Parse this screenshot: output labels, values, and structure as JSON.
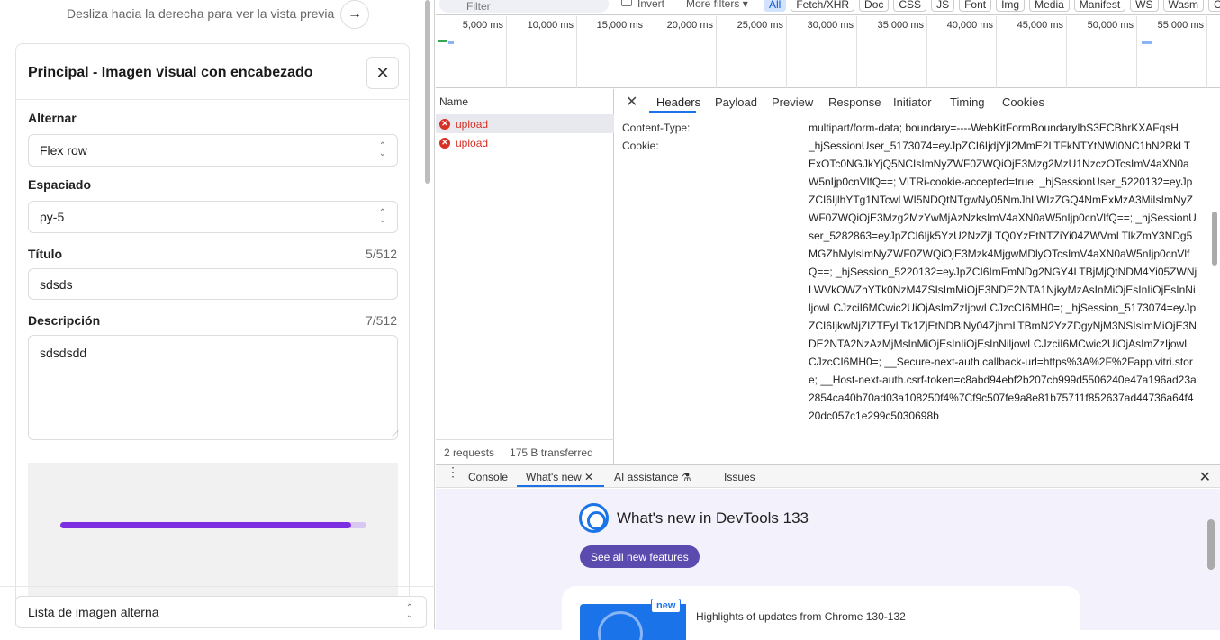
{
  "left": {
    "hint": "Desliza hacia la derecha para ver la vista previa",
    "panel": {
      "title": "Principal - Imagen visual con encabezado",
      "alternar": {
        "label": "Alternar",
        "value": "Flex row"
      },
      "espaciado": {
        "label": "Espaciado",
        "value": "py-5"
      },
      "titulo": {
        "label": "Título",
        "count": "5/512",
        "value": "sdsds"
      },
      "descripcion": {
        "label": "Descripción",
        "count": "7/512",
        "value": "sdsdsdd"
      },
      "progress": 0.95
    },
    "bottom_select": "Lista de imagen alterna"
  },
  "devtools": {
    "filter": {
      "placeholder": "Filter",
      "invert": "Invert",
      "more_filters": "More filters",
      "chips": [
        "All",
        "Fetch/XHR",
        "Doc",
        "CSS",
        "JS",
        "Font",
        "Img",
        "Media",
        "Manifest",
        "WS",
        "Wasm",
        "Other"
      ]
    },
    "timeline_ticks": [
      "5,000 ms",
      "10,000 ms",
      "15,000 ms",
      "20,000 ms",
      "25,000 ms",
      "30,000 ms",
      "35,000 ms",
      "40,000 ms",
      "45,000 ms",
      "50,000 ms",
      "55,000 ms"
    ],
    "name_header": "Name",
    "requests": [
      "upload",
      "upload"
    ],
    "status": {
      "requests": "2 requests",
      "transferred": "175 B transferred"
    },
    "tabs": [
      "Headers",
      "Payload",
      "Preview",
      "Response",
      "Initiator",
      "Timing",
      "Cookies"
    ],
    "headers": [
      {
        "name": "Content-Type:",
        "value": "multipart/form-data; boundary=----WebKitFormBoundaryIbS3ECBhrKXAFqsH"
      },
      {
        "name": "Cookie:",
        "value": "_hjSessionUser_5173074=eyJpZCI6IjdjYjI2MmE2LTFkNTYtNWI0NC1hN2RkLTExOTc0NGJkYjQ5NCIsImNyZWF0ZWQiOjE3Mzg2MzU1NzczOTcsImV4aXN0aW5nIjp0cnVlfQ==; VITRi-cookie-accepted=true; _hjSessionUser_5220132=eyJpZCI6IjlhYTg1NTcwLWI5NDQtNTgwNy05NmJhLWIzZGQ4NmExMzA3MiIsImNyZWF0ZWQiOjE3Mzg2MzYwMjAzNzksImV4aXN0aW5nIjp0cnVlfQ==; _hjSessionUser_5282863=eyJpZCI6Ijk5YzU2NzZjLTQ0YzEtNTZiYi04ZWVmLTlkZmY3NDg5MGZhMyIsImNyZWF0ZWQiOjE3Mzk4MjgwMDlyOTcsImV4aXN0aW5nIjp0cnVlfQ==; _hjSession_5220132=eyJpZCI6ImFmNDg2NGY4LTBjMjQtNDM4Yi05ZWNjLWVkOWZhYTk0NzM4ZSIsImMiOjE3NDE2NTA1NjkyMzAsInMiOjEsInIiOjEsInNiljowLCJzciI6MCwic2UiOjAsImZzIjowLCJzcCI6MH0=; _hjSession_5173074=eyJpZCI6IjkwNjZlZTEyLTk1ZjEtNDBlNy04ZjhmLTBmN2YzZDgyNjM3NSIsImMiOjE3NDE2NTA2NzAzMjMsInMiOjEsInIiOjEsInNiljowLCJzciI6MCwic2UiOjAsImZzIjowLCJzcCI6MH0=; __Secure-next-auth.callback-url=https%3A%2F%2Fapp.vitri.store; __Host-next-auth.csrf-token=c8abd94ebf2b207cb999d5506240e47a196ad23a2854ca40b70ad03a108250f4%7Cf9c507fe9a8e81b75711f852637ad44736a64f420dc057c1e299c5030698b"
      }
    ],
    "drawer": {
      "tabs": [
        "Console",
        "What's new",
        "AI assistance",
        "Issues"
      ],
      "title": "What's new in DevTools 133",
      "button": "See all new features",
      "badge": "new",
      "highlight": "Highlights of updates from Chrome 130-132"
    },
    "colors": {
      "accent": "#1a73e8",
      "error": "#d93025",
      "purple": "#7b2fe0"
    }
  }
}
